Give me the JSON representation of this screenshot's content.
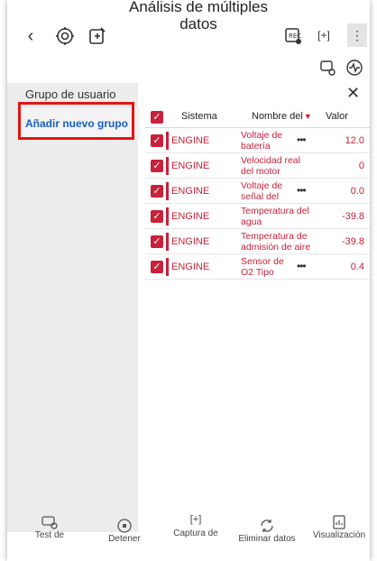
{
  "header": {
    "title_line1": "Análisis de múltiples",
    "title_line2": "datos",
    "back_icon": "chevron-left-icon",
    "icons": [
      "gear-scan-icon",
      "report-export-icon",
      "record-icon",
      "expand-icon",
      "more-icon",
      "car-settings-icon",
      "signal-icon"
    ]
  },
  "panel": {
    "title": "Grupo de usuario",
    "add_group": "Añadir nuevo grupo"
  },
  "table": {
    "columns": [
      "Sistema",
      "Nombre del",
      "Valor"
    ],
    "rows": [
      {
        "system": "ENGINE",
        "name_l1": "Voltaje de",
        "name_l2": "batería",
        "value": "12.0",
        "dots": true
      },
      {
        "system": "ENGINE",
        "name_l1": "Velocidad real",
        "name_l2": "del motor",
        "value": "0",
        "dots": false
      },
      {
        "system": "ENGINE",
        "name_l1": "Voltaje de",
        "name_l2": "señal del",
        "value": "0.0",
        "dots": true
      },
      {
        "system": "ENGINE",
        "name_l1": "Temperatura del",
        "name_l2": "agua",
        "value": "-39.8",
        "dots": false
      },
      {
        "system": "ENGINE",
        "name_l1": "Temperatura de",
        "name_l2": "admisión de aire",
        "value": "-39.8",
        "dots": false
      },
      {
        "system": "ENGINE",
        "name_l1": "Sensor de",
        "name_l2": "O2 Tipo",
        "value": "0.4",
        "dots": true
      }
    ]
  },
  "bottom": {
    "test": "Test de",
    "stop": "Detener",
    "capture": "Captura de",
    "delete": "Eliminar datos",
    "view": "Visualización"
  },
  "colors": {
    "accent": "#c8213a",
    "link": "#1a5fbf",
    "highlight": "#e41414"
  }
}
